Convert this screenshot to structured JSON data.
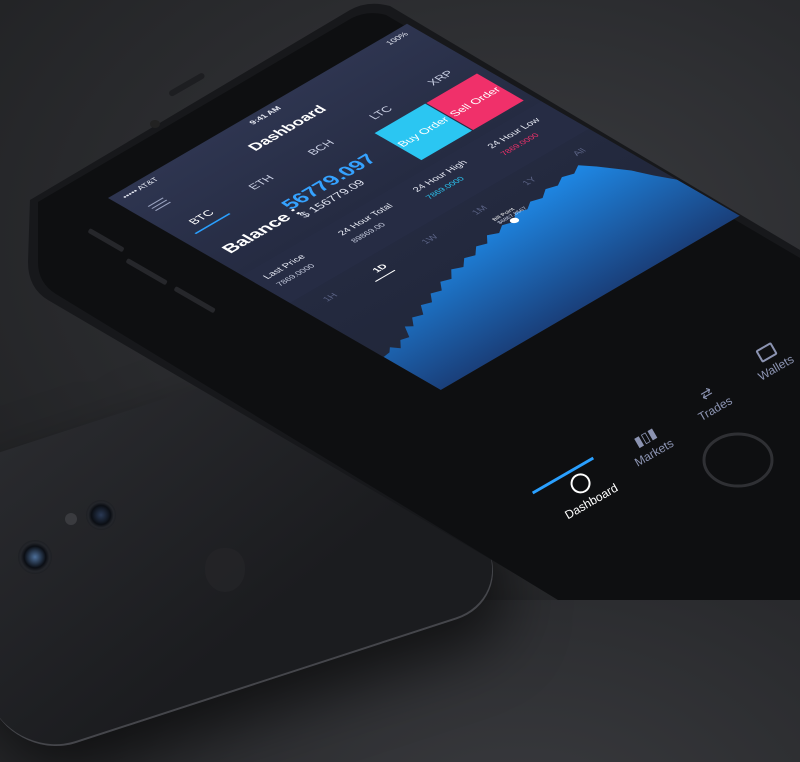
{
  "status_bar": {
    "carrier": "••••• AT&T",
    "time": "9:41 AM",
    "battery": "100%"
  },
  "header": {
    "title": "Dashboard"
  },
  "tabs": [
    {
      "label": "BTC",
      "active": true
    },
    {
      "label": "ETH",
      "active": false
    },
    {
      "label": "BCH",
      "active": false
    },
    {
      "label": "LTC",
      "active": false
    },
    {
      "label": "XRP",
      "active": false
    }
  ],
  "balance": {
    "label": "Balance :",
    "amount": "56779.097",
    "usd": "$ 156779.09"
  },
  "actions": {
    "buy": "Buy Order",
    "sell": "Sell Order"
  },
  "stats": [
    {
      "label": "Last Price",
      "value": "7869.0000"
    },
    {
      "label": "24 Hour Total",
      "value": "89869.00"
    },
    {
      "label": "24 Hour High",
      "value": "7869.0000"
    },
    {
      "label": "24 Hour Low",
      "value": "7869.0000"
    }
  ],
  "ranges": [
    {
      "label": "1H",
      "active": false
    },
    {
      "label": "1D",
      "active": true
    },
    {
      "label": "1W",
      "active": false
    },
    {
      "label": "1M",
      "active": false
    },
    {
      "label": "1Y",
      "active": false
    },
    {
      "label": "All",
      "active": false
    }
  ],
  "chart_point": {
    "label": "Bill Point",
    "value": "$6867.8567"
  },
  "bottom_nav": [
    {
      "label": "Dashboard",
      "icon": "dashboard-icon",
      "active": true
    },
    {
      "label": "Markets",
      "icon": "bar-chart-icon",
      "active": false
    },
    {
      "label": "Trades",
      "icon": "trades-icon",
      "active": false
    },
    {
      "label": "Wallets",
      "icon": "wallet-icon",
      "active": false
    }
  ],
  "colors": {
    "accent_blue": "#2aa0ff",
    "buy": "#2bc6f2",
    "sell": "#f0306a",
    "screen_bg": "#252b42"
  }
}
